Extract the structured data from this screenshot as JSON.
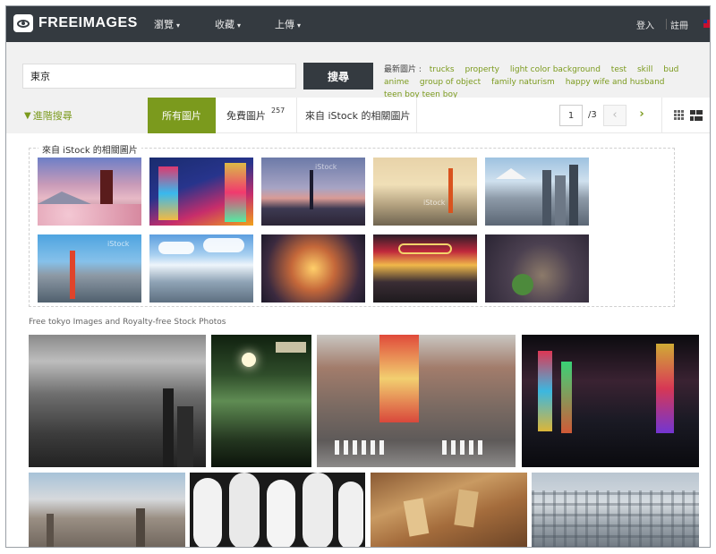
{
  "brand": {
    "name": "FREEIMAGES"
  },
  "nav": {
    "browse": "瀏覽",
    "collections": "收藏",
    "upload": "上傳",
    "login": "登入",
    "register": "註冊"
  },
  "search": {
    "value": "東京",
    "button_label": "搜尋",
    "latest_label": "最新圖片 :",
    "latest_tags": [
      "trucks",
      "property",
      "light color background",
      "test",
      "skill",
      "bud",
      "anime",
      "group of object",
      "family naturism",
      "happy wife and husband",
      "teen boy teen boy"
    ]
  },
  "filters": {
    "advanced": "進階搜尋",
    "tab_all": "所有圖片",
    "tab_free": "免費圖片",
    "free_count": "257",
    "tab_istock": "來自 iStock 的相關圖片"
  },
  "pagination": {
    "current": "1",
    "of_total": "/3"
  },
  "istock": {
    "title": "來自 iStock 的相關圖片",
    "watermark": "iStock"
  },
  "free_section": {
    "title": "Free tokyo Images and Royalty-free Stock Photos"
  },
  "colors": {
    "topbar": "#343a40",
    "accent_green": "#7b9a1d"
  }
}
